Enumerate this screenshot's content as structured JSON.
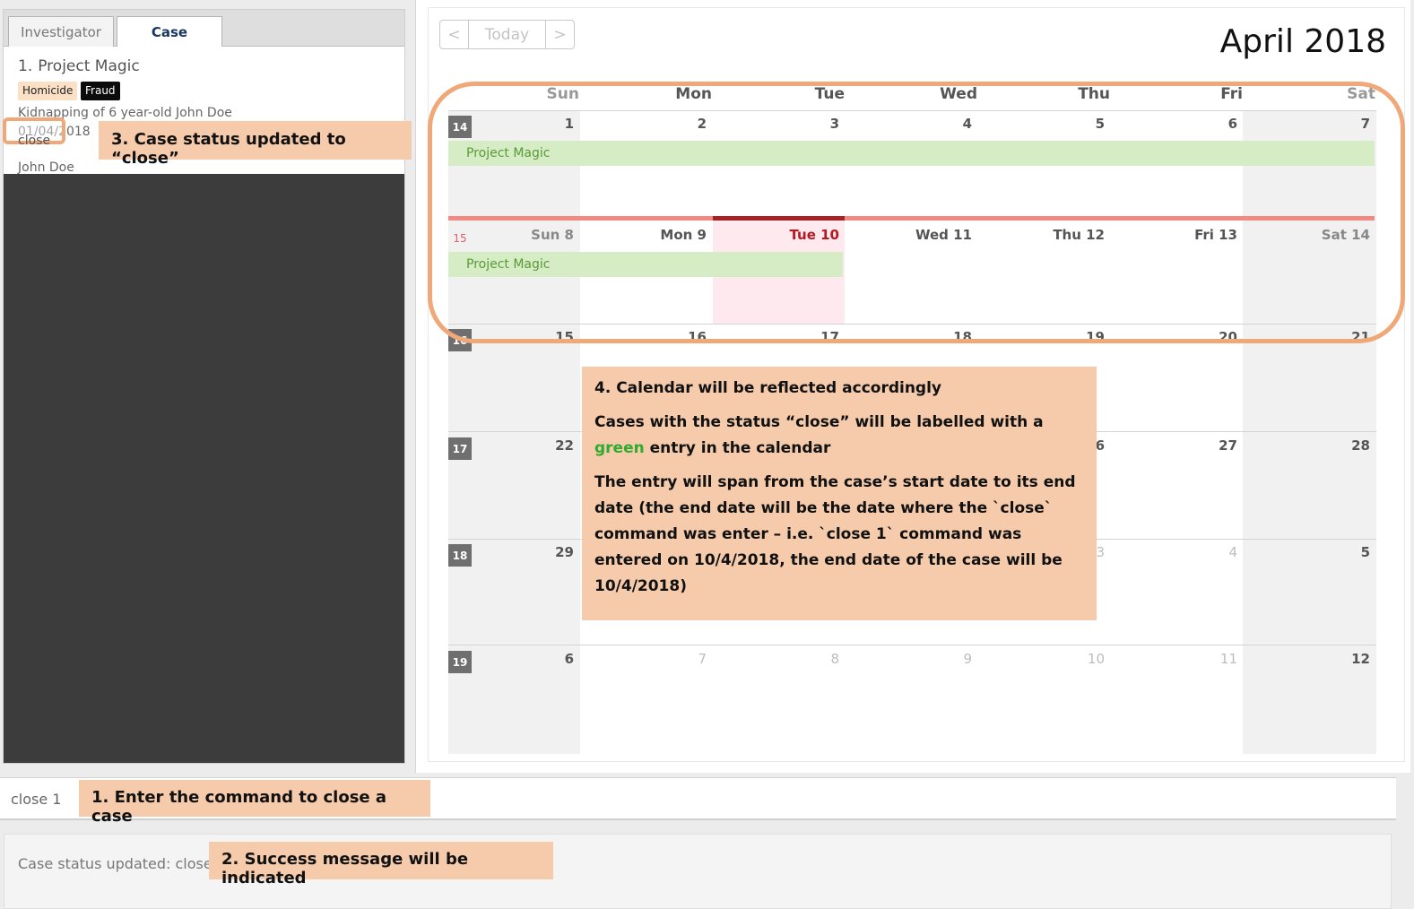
{
  "tabs": {
    "investigator": "Investigator",
    "case": "Case"
  },
  "case_card": {
    "index": "1.",
    "title": "Project Magic",
    "tags": [
      "Homicide",
      "Fraud"
    ],
    "description": "Kidnapping of 6 year-old John Doe",
    "date": "01/04/2018",
    "status": "close",
    "person": "John Doe"
  },
  "calendar": {
    "nav_prev": "<",
    "nav_today": "Today",
    "nav_next": ">",
    "month_title": "April 2018",
    "weekdays": [
      "Sun",
      "Mon",
      "Tue",
      "Wed",
      "Thu",
      "Fri",
      "Sat"
    ],
    "week_numbers": [
      "14",
      "15",
      "16",
      "17",
      "18",
      "19"
    ],
    "week2_headers": [
      "Sun 8",
      "Mon 9",
      "Tue 10",
      "Wed 11",
      "Thu 12",
      "Fri 13",
      "Sat 14"
    ],
    "row1_days": [
      "1",
      "2",
      "3",
      "4",
      "5",
      "6",
      "7"
    ],
    "row3_days": [
      "15",
      "16",
      "17",
      "18",
      "19",
      "20",
      "21"
    ],
    "row4_days": [
      "22",
      "",
      "",
      "",
      "",
      "27",
      "28"
    ],
    "row4_partial": "6",
    "row5_days": [
      "29",
      "",
      "",
      "",
      "",
      "4",
      "5"
    ],
    "row5_partial": "3",
    "row6_days": [
      "6",
      "7",
      "8",
      "9",
      "10",
      "11",
      "12"
    ],
    "event_label": "Project Magic",
    "accent_event": "#d6ecc4",
    "accent_today": "#b61820"
  },
  "notes": {
    "note1": "1. Enter the command to close a case",
    "note2": "2. Success message will be indicated",
    "note3": "3. Case status updated to “close”",
    "note4_title": "4. Calendar will be reflected accordingly",
    "note4_p2_pre": "Cases with the status “close” will be labelled with a",
    "note4_p2_green": "green",
    "note4_p2_post": "entry in the calendar",
    "note4_p3": "The entry will span from the case’s start date to its end date (the end date will be the date where the `close` command was enter – i.e. `close 1` command was entered on 10/4/2018, the end date of the case will be 10/4/2018)"
  },
  "command": {
    "value": "close 1"
  },
  "result": {
    "text": "Case status updated: close"
  }
}
